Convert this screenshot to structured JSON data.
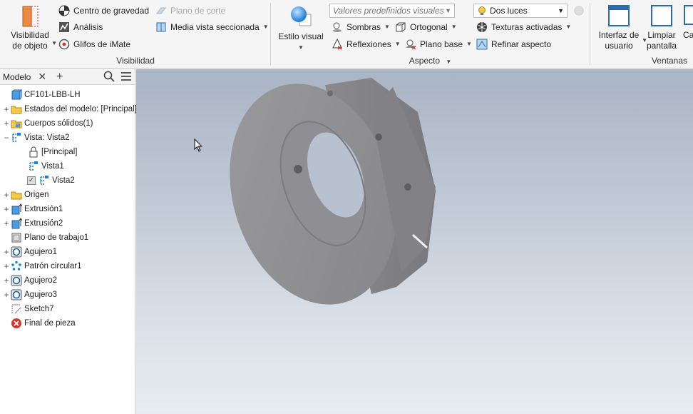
{
  "ribbon": {
    "visibility_panel": {
      "title": "Visibilidad",
      "object_visibility": "Visibilidad\nde objeto",
      "center_of_gravity": "Centro de gravedad",
      "analysis": "Análisis",
      "imate_glyphs": "Glifos de iMate",
      "section_plane": "Plano de corte",
      "half_section": "Media vista seccionada"
    },
    "appearance_panel": {
      "title": "Aspecto",
      "visual_style": "Estilo visual",
      "visual_presets_placeholder": "Valores predefinidos visuales",
      "lighting_value": "Dos luces",
      "shadows": "Sombras",
      "orthographic": "Ortogonal",
      "textures": "Texturas activadas",
      "reflections": "Reflexiones",
      "ground_plane": "Plano base",
      "refine_appearance": "Refinar aspecto"
    },
    "windows_panel": {
      "title": "Ventanas",
      "user_interface": "Interfaz de\nusuario",
      "clean_screen": "Limpiar\npantalla",
      "cascade_partial": "Ca"
    }
  },
  "browser": {
    "tab_label": "Modelo",
    "items": [
      {
        "label": "CF101-LBB-LH",
        "icon": "part-icon",
        "expander": ""
      },
      {
        "label": "Estados del modelo: [Principal]",
        "icon": "folder-icon",
        "expander": "+"
      },
      {
        "label": "Cuerpos sólidos(1)",
        "icon": "solid-bodies-folder-icon",
        "expander": "+"
      },
      {
        "label": "Vista: Vista2",
        "icon": "view-rep-icon",
        "expander": "−"
      },
      {
        "label": "[Principal]",
        "icon": "lock-icon",
        "expander": ""
      },
      {
        "label": "Vista1",
        "icon": "view-rep-icon",
        "expander": ""
      },
      {
        "label": "Vista2",
        "icon": "view-rep-icon",
        "expander": ""
      },
      {
        "label": "Origen",
        "icon": "folder-icon",
        "expander": "+"
      },
      {
        "label": "Extrusión1",
        "icon": "extrusion-icon",
        "expander": "+"
      },
      {
        "label": "Extrusión2",
        "icon": "extrusion-icon",
        "expander": "+"
      },
      {
        "label": "Plano de trabajo1",
        "icon": "work-plane-icon",
        "expander": ""
      },
      {
        "label": "Agujero1",
        "icon": "hole-icon",
        "expander": "+"
      },
      {
        "label": "Patrón circular1",
        "icon": "circular-pattern-icon",
        "expander": "+"
      },
      {
        "label": "Agujero2",
        "icon": "hole-icon",
        "expander": "+"
      },
      {
        "label": "Agujero3",
        "icon": "hole-icon",
        "expander": "+"
      },
      {
        "label": "Sketch7",
        "icon": "sketch-icon",
        "expander": ""
      },
      {
        "label": "Final de pieza",
        "icon": "end-of-part-icon",
        "expander": ""
      }
    ]
  },
  "colors": {
    "accent_blue": "#1f7fd6",
    "folder_yellow": "#f2c94c",
    "error_red": "#d9342b",
    "part_gray": "#8e8e90"
  }
}
